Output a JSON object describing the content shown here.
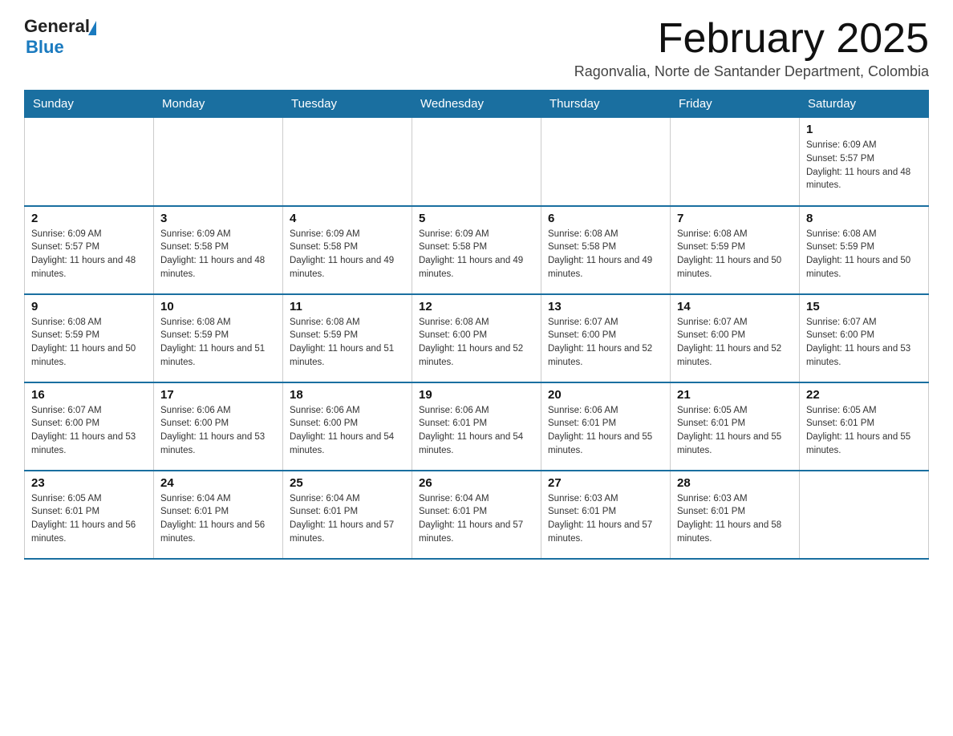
{
  "header": {
    "logo_general": "General",
    "logo_blue": "Blue",
    "title": "February 2025",
    "subtitle": "Ragonvalia, Norte de Santander Department, Colombia"
  },
  "days_of_week": [
    "Sunday",
    "Monday",
    "Tuesday",
    "Wednesday",
    "Thursday",
    "Friday",
    "Saturday"
  ],
  "weeks": [
    [
      {
        "day": "",
        "info": ""
      },
      {
        "day": "",
        "info": ""
      },
      {
        "day": "",
        "info": ""
      },
      {
        "day": "",
        "info": ""
      },
      {
        "day": "",
        "info": ""
      },
      {
        "day": "",
        "info": ""
      },
      {
        "day": "1",
        "info": "Sunrise: 6:09 AM\nSunset: 5:57 PM\nDaylight: 11 hours and 48 minutes."
      }
    ],
    [
      {
        "day": "2",
        "info": "Sunrise: 6:09 AM\nSunset: 5:57 PM\nDaylight: 11 hours and 48 minutes."
      },
      {
        "day": "3",
        "info": "Sunrise: 6:09 AM\nSunset: 5:58 PM\nDaylight: 11 hours and 48 minutes."
      },
      {
        "day": "4",
        "info": "Sunrise: 6:09 AM\nSunset: 5:58 PM\nDaylight: 11 hours and 49 minutes."
      },
      {
        "day": "5",
        "info": "Sunrise: 6:09 AM\nSunset: 5:58 PM\nDaylight: 11 hours and 49 minutes."
      },
      {
        "day": "6",
        "info": "Sunrise: 6:08 AM\nSunset: 5:58 PM\nDaylight: 11 hours and 49 minutes."
      },
      {
        "day": "7",
        "info": "Sunrise: 6:08 AM\nSunset: 5:59 PM\nDaylight: 11 hours and 50 minutes."
      },
      {
        "day": "8",
        "info": "Sunrise: 6:08 AM\nSunset: 5:59 PM\nDaylight: 11 hours and 50 minutes."
      }
    ],
    [
      {
        "day": "9",
        "info": "Sunrise: 6:08 AM\nSunset: 5:59 PM\nDaylight: 11 hours and 50 minutes."
      },
      {
        "day": "10",
        "info": "Sunrise: 6:08 AM\nSunset: 5:59 PM\nDaylight: 11 hours and 51 minutes."
      },
      {
        "day": "11",
        "info": "Sunrise: 6:08 AM\nSunset: 5:59 PM\nDaylight: 11 hours and 51 minutes."
      },
      {
        "day": "12",
        "info": "Sunrise: 6:08 AM\nSunset: 6:00 PM\nDaylight: 11 hours and 52 minutes."
      },
      {
        "day": "13",
        "info": "Sunrise: 6:07 AM\nSunset: 6:00 PM\nDaylight: 11 hours and 52 minutes."
      },
      {
        "day": "14",
        "info": "Sunrise: 6:07 AM\nSunset: 6:00 PM\nDaylight: 11 hours and 52 minutes."
      },
      {
        "day": "15",
        "info": "Sunrise: 6:07 AM\nSunset: 6:00 PM\nDaylight: 11 hours and 53 minutes."
      }
    ],
    [
      {
        "day": "16",
        "info": "Sunrise: 6:07 AM\nSunset: 6:00 PM\nDaylight: 11 hours and 53 minutes."
      },
      {
        "day": "17",
        "info": "Sunrise: 6:06 AM\nSunset: 6:00 PM\nDaylight: 11 hours and 53 minutes."
      },
      {
        "day": "18",
        "info": "Sunrise: 6:06 AM\nSunset: 6:00 PM\nDaylight: 11 hours and 54 minutes."
      },
      {
        "day": "19",
        "info": "Sunrise: 6:06 AM\nSunset: 6:01 PM\nDaylight: 11 hours and 54 minutes."
      },
      {
        "day": "20",
        "info": "Sunrise: 6:06 AM\nSunset: 6:01 PM\nDaylight: 11 hours and 55 minutes."
      },
      {
        "day": "21",
        "info": "Sunrise: 6:05 AM\nSunset: 6:01 PM\nDaylight: 11 hours and 55 minutes."
      },
      {
        "day": "22",
        "info": "Sunrise: 6:05 AM\nSunset: 6:01 PM\nDaylight: 11 hours and 55 minutes."
      }
    ],
    [
      {
        "day": "23",
        "info": "Sunrise: 6:05 AM\nSunset: 6:01 PM\nDaylight: 11 hours and 56 minutes."
      },
      {
        "day": "24",
        "info": "Sunrise: 6:04 AM\nSunset: 6:01 PM\nDaylight: 11 hours and 56 minutes."
      },
      {
        "day": "25",
        "info": "Sunrise: 6:04 AM\nSunset: 6:01 PM\nDaylight: 11 hours and 57 minutes."
      },
      {
        "day": "26",
        "info": "Sunrise: 6:04 AM\nSunset: 6:01 PM\nDaylight: 11 hours and 57 minutes."
      },
      {
        "day": "27",
        "info": "Sunrise: 6:03 AM\nSunset: 6:01 PM\nDaylight: 11 hours and 57 minutes."
      },
      {
        "day": "28",
        "info": "Sunrise: 6:03 AM\nSunset: 6:01 PM\nDaylight: 11 hours and 58 minutes."
      },
      {
        "day": "",
        "info": ""
      }
    ]
  ]
}
